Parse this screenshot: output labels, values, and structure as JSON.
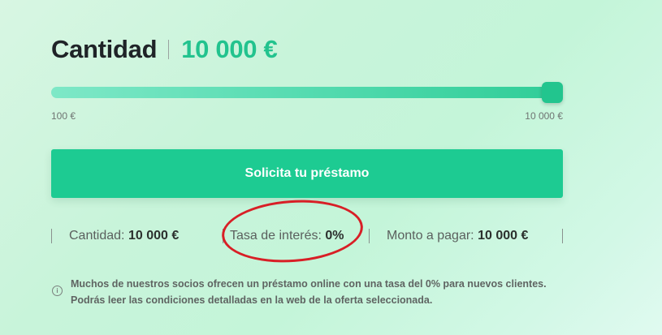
{
  "header": {
    "label": "Cantidad",
    "amount": "10 000 €"
  },
  "slider": {
    "min_label": "100 €",
    "max_label": "10 000 €",
    "value_fraction": 1.0
  },
  "cta": {
    "label": "Solicita tu préstamo"
  },
  "summary": {
    "amount_label": "Cantidad:",
    "amount_value": "10 000 €",
    "rate_label": "Tasa de interés:",
    "rate_value": "0%",
    "total_label": "Monto a pagar:",
    "total_value": "10 000 €"
  },
  "info": {
    "icon": "info-icon",
    "text": "Muchos de nuestros socios ofrecen un préstamo online con una tasa del 0% para nuevos clientes. Podrás leer las condiciones detalladas en la web de la oferta seleccionada."
  },
  "colors": {
    "accent": "#1dcb92",
    "annotation": "#d81f26"
  }
}
